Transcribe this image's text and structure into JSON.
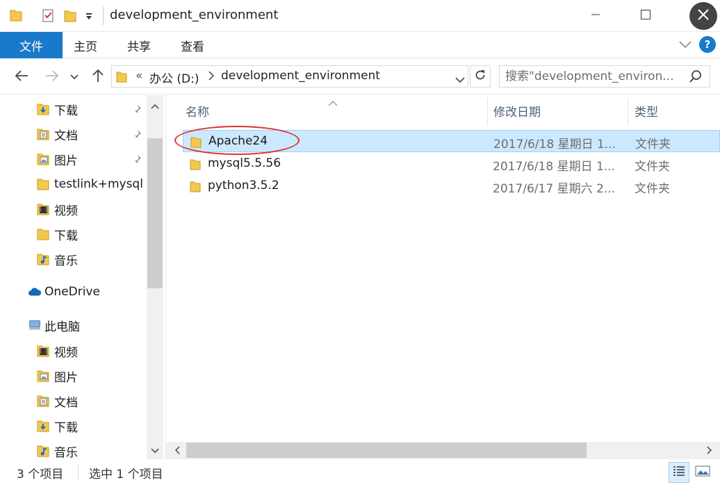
{
  "window": {
    "title": "development_environment",
    "icons": [
      "folder-icon",
      "properties-icon",
      "new-folder-icon",
      "customize-qat-icon",
      "minimize-icon",
      "maximize-icon",
      "close-icon"
    ]
  },
  "ribbon": {
    "file_tab": "文件",
    "tabs": [
      "主页",
      "共享",
      "查看"
    ]
  },
  "address": {
    "overflow": "«",
    "drive": "办公 (D:)",
    "folder": "development_environment",
    "search_placeholder": "搜索\"development_environ..."
  },
  "nav": {
    "quick": [
      {
        "label": "下载",
        "icon": "download-folder-icon",
        "pinned": true
      },
      {
        "label": "文档",
        "icon": "documents-folder-icon",
        "pinned": true
      },
      {
        "label": "图片",
        "icon": "pictures-folder-icon",
        "pinned": true
      },
      {
        "label": "testlink+mysql",
        "icon": "folder-icon",
        "pinned": false
      },
      {
        "label": "视频",
        "icon": "videos-folder-icon",
        "pinned": false
      },
      {
        "label": "下载",
        "icon": "folder-icon",
        "pinned": false
      },
      {
        "label": "音乐",
        "icon": "music-folder-icon",
        "pinned": false
      }
    ],
    "onedrive": "OneDrive",
    "thispc": "此电脑",
    "pc_items": [
      {
        "label": "视频",
        "icon": "videos-folder-icon"
      },
      {
        "label": "图片",
        "icon": "pictures-folder-icon"
      },
      {
        "label": "文档",
        "icon": "documents-folder-icon"
      },
      {
        "label": "下载",
        "icon": "download-folder-icon"
      },
      {
        "label": "音乐",
        "icon": "music-folder-icon"
      }
    ]
  },
  "columns": {
    "name": "名称",
    "date": "修改日期",
    "type": "类型"
  },
  "files": [
    {
      "name": "Apache24",
      "date": "2017/6/18 星期日 1...",
      "type": "文件夹",
      "selected": true
    },
    {
      "name": "mysql5.5.56",
      "date": "2017/6/18 星期日 1...",
      "type": "文件夹",
      "selected": false
    },
    {
      "name": "python3.5.2",
      "date": "2017/6/17 星期六 2...",
      "type": "文件夹",
      "selected": false
    }
  ],
  "status": {
    "count": "3 个项目",
    "selected": "选中 1 个项目"
  },
  "colors": {
    "accent": "#1979ca",
    "selection": "#cce8ff",
    "folder": "#f2c94c",
    "annotation_circle": "#e0312c"
  }
}
